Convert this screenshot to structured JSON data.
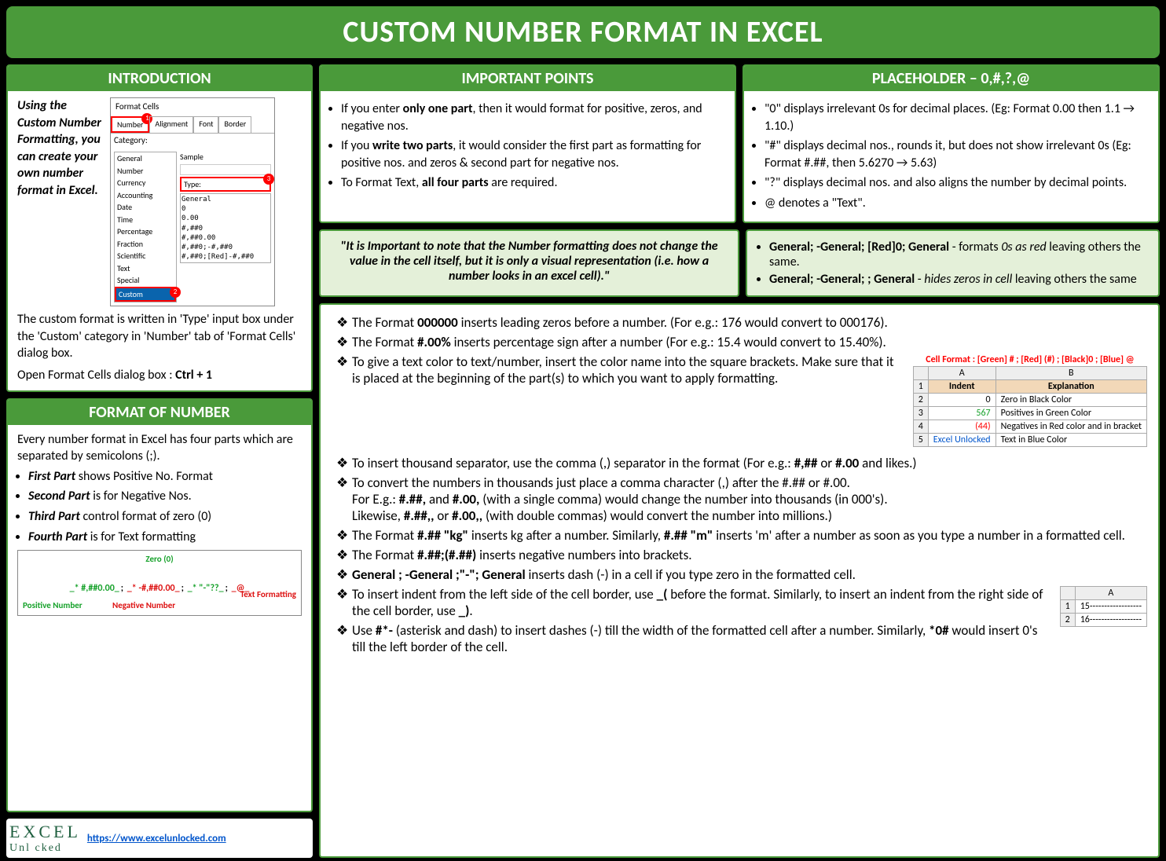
{
  "title": "CUSTOM NUMBER FORMAT IN EXCEL",
  "intro": {
    "header": "INTRODUCTION",
    "lead": "Using the Custom Number Formatting, you can create your own number format in Excel.",
    "p1": "The custom format is written in 'Type' input box under the 'Custom' category in 'Number' tab of 'Format Cells' dialog box.",
    "p2_pre": "Open Format Cells dialog box : ",
    "p2_key": "Ctrl + 1",
    "dialog": {
      "title": "Format Cells",
      "tabs": [
        "Number",
        "Alignment",
        "Font",
        "Border"
      ],
      "cat_label": "Category:",
      "cats": [
        "General",
        "Number",
        "Currency",
        "Accounting",
        "Date",
        "Time",
        "Percentage",
        "Fraction",
        "Scientific",
        "Text",
        "Special",
        "Custom"
      ],
      "sample": "Sample",
      "type": "Type:",
      "fmts": [
        "General",
        "0",
        "0.00",
        "#,##0",
        "#,##0.00",
        "#,##0;-#,##0",
        "#,##0;[Red]-#,##0"
      ]
    }
  },
  "important": {
    "header": "IMPORTANT POINTS",
    "b1_a": "If you enter ",
    "b1_b": "only one part",
    "b1_c": ", then it would format for positive, zeros, and negative nos.",
    "b2_a": "If you ",
    "b2_b": "write two parts",
    "b2_c": ", it would consider the first part as formatting for positive nos. and zeros & second part for negative nos.",
    "b3_a": "To Format Text, ",
    "b3_b": "all four parts",
    "b3_c": " are required.",
    "note": "\"It is Important to note that the Number formatting does not change the value in the cell itself, but it is only a visual representation (i.e. how a number looks in an excel cell).\""
  },
  "placeholder": {
    "header": "PLACEHOLDER – 0,#,?,@",
    "b1": "\"0\" displays irrelevant 0s for decimal places. (Eg: Format 0.00 then 1.1 → 1.10.)",
    "b2": "\"#\" displays decimal nos., rounds it, but does not show irrelevant 0s (Eg: Format  #.##, then 5.6270 → 5.63)",
    "b3": "\"?\" displays decimal nos. and also aligns the number by decimal points.",
    "b4": "@ denotes a \"Text\".",
    "ex1_code": "General; -General; [Red]0; General",
    "ex1_desc": " - formats ",
    "ex1_em": "0s as red",
    "ex1_tail": " leaving others the same.",
    "ex2_code": "General; -General; ; General",
    "ex2_desc": " - ",
    "ex2_em": "hides zeros in cell",
    "ex2_tail": " leaving others the same"
  },
  "format_of_number": {
    "header": "FORMAT OF NUMBER",
    "intro": "Every number format in Excel has four parts which are separated by semicolons (;).",
    "p1_b": "First Part",
    "p1_t": " shows Positive No. Format",
    "p2_b": "Second Part",
    "p2_t": " is for Negative Nos.",
    "p3_b": "Third Part",
    "p3_t": " control format of zero (0)",
    "p4_b": "Fourth Part",
    "p4_t": " is for Text formatting",
    "diag": {
      "zero": "Zero (0)",
      "pos": "Positive Number",
      "neg": "Negative Number",
      "txt": "Text Formatting",
      "s1": "_* #,##0.00_",
      "s2": "_* -#,##0.00_",
      "s3": "_* \"-\"??_",
      "s4": "_@_"
    }
  },
  "tips": {
    "t1a": "The Format ",
    "t1b": "000000",
    "t1c": " inserts leading zeros before a number. (For e.g.: 176 would convert to 000176).",
    "t2a": "The Format ",
    "t2b": "#.00%",
    "t2c": " inserts percentage sign after a number (For e.g.: 15.4 would convert to 15.40%).",
    "t3": "To give a text color to text/number, insert the color name into the square brackets. Make sure that it is placed at the beginning of the part(s) to which you want to apply formatting.",
    "t4a": "To insert thousand separator, use the comma (,) separator in the format (For e.g.: ",
    "t4b": "#,##",
    "t4c": " or ",
    "t4d": "#.00",
    "t4e": " and likes.)",
    "t5a": "To convert the numbers in thousands just place a comma character (,) after the #.## or #.00.",
    "t5b": "For E.g.: ",
    "t5c": "#.##,",
    "t5d": " and ",
    "t5e": "#.00,",
    "t5f": " (with a single comma) would change the number into thousands (in 000's).",
    "t5g": "Likewise, ",
    "t5h": "#.##,,",
    "t5i": " or ",
    "t5j": "#.00,,",
    "t5k": " (with double commas) would convert the number into millions.)",
    "t6a": "The Format ",
    "t6b": "#.## \"kg\"",
    "t6c": " inserts kg after a number. Similarly, ",
    "t6d": "#.## \"m\"",
    "t6e": " inserts 'm' after a number as soon as you type a number in a formatted cell.",
    "t7a": "The Format ",
    "t7b": "#.##;(#.##)",
    "t7c": " inserts negative numbers into brackets.",
    "t8a": "General ; -General ;\"-\"; General",
    "t8b": " inserts dash (-) in a cell if you type zero in the formatted cell.",
    "t9a": "To insert indent from the left side of the cell border, use ",
    "t9b": "_(",
    "t9c": " before the format. Similarly, to insert an indent from the right side of the cell border, use ",
    "t9d": "_)",
    "t9e": ".",
    "t10a": "Use ",
    "t10b": "#*-",
    "t10c": " (asterisk and dash) to insert dashes (-) till the width of the formatted cell after a number. Similarly, ",
    "t10d": "*0#",
    "t10e": " would insert 0's till the left border of the cell."
  },
  "color_table": {
    "title": "Cell Format : [Green] # ; [Red] (#) ; [Black]0 ; [Blue] @",
    "h1": "Indent",
    "h2": "Explanation",
    "r1a": "0",
    "r1b": "Zero in Black Color",
    "r2a": "567",
    "r2b": "Positives in Green Color",
    "r3a": "(44)",
    "r3b": "Negatives in Red color and in bracket",
    "r4a": "Excel Unlocked",
    "r4b": "Text in Blue Color"
  },
  "dash_table": {
    "colA": "A",
    "r1": "15------------------",
    "r2": "16------------------"
  },
  "logo": {
    "l1": "EXCEL",
    "l2": "Unl  cked",
    "url": "https://www.excelunlocked.com"
  }
}
